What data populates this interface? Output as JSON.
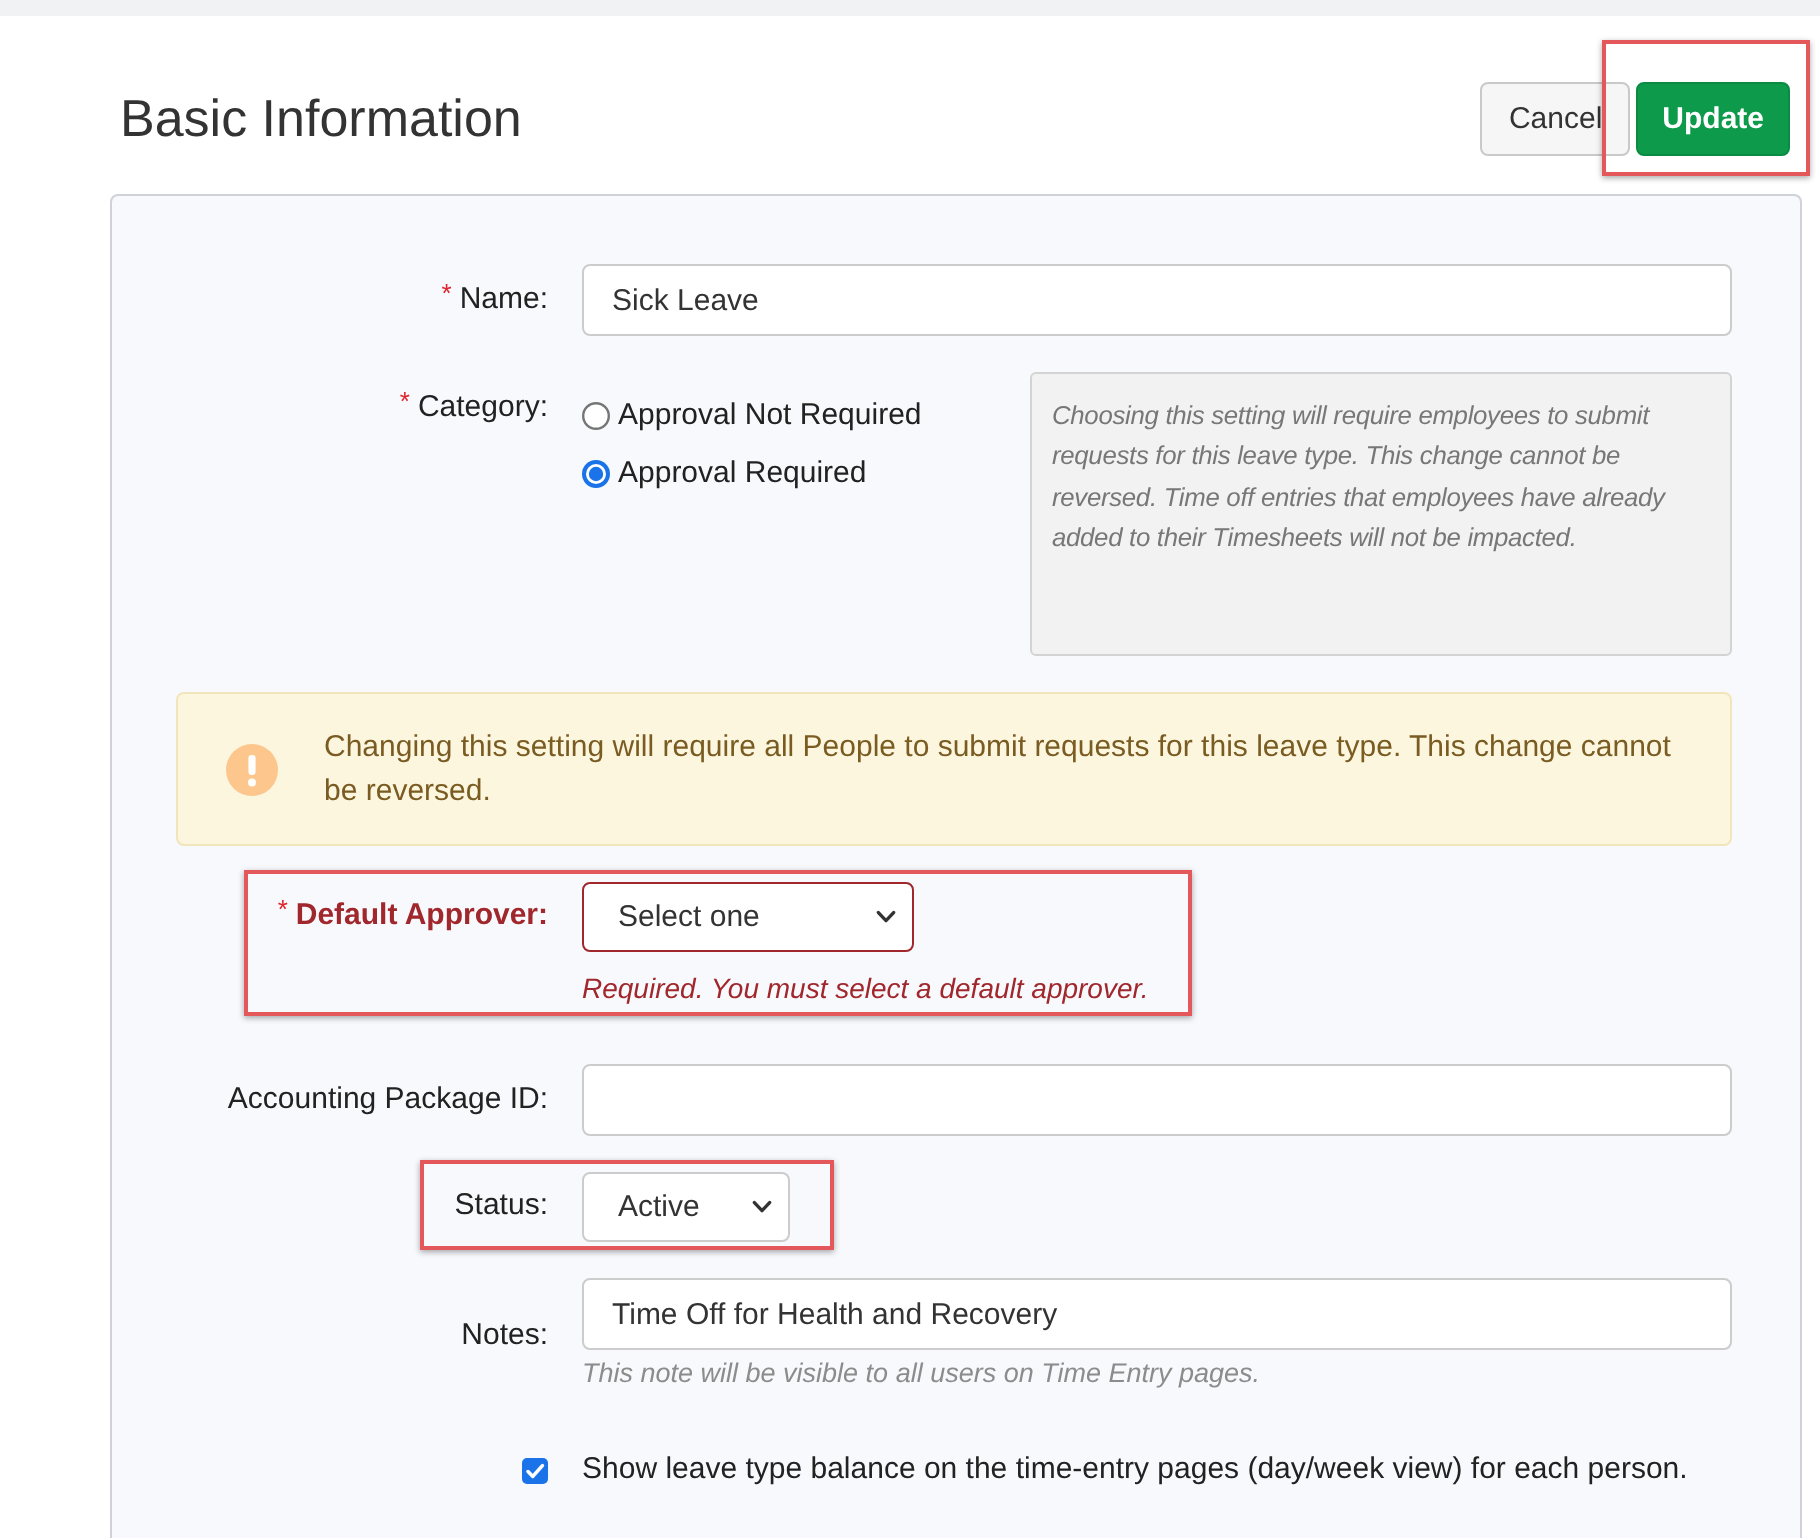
{
  "page": {
    "title": "Basic Information"
  },
  "actions": [
    {
      "label": "Cancel",
      "kind": "secondary",
      "highlighted": false
    },
    {
      "label": "Update",
      "kind": "primary",
      "highlighted": true
    }
  ],
  "rows": [
    {
      "kind": "text",
      "marker": "*",
      "label": "Name:",
      "value": "Sick Leave",
      "invalid": false,
      "highlighted": false
    },
    {
      "kind": "radio",
      "marker": "*",
      "label": "Category:",
      "options": [
        {
          "label": "Approval Not Required",
          "selected": false
        },
        {
          "label": "Approval Required",
          "selected": true
        }
      ],
      "info": "Choosing this setting will require employees to submit requests for this leave type. This change cannot be reversed. Time off entries that employees have already added to their Timesheets will not be impacted.",
      "invalid": false,
      "highlighted": false
    },
    {
      "kind": "alert",
      "text": "Changing this setting will require all People to submit requests for this leave type. This change cannot be reversed."
    },
    {
      "kind": "select",
      "marker": "*",
      "label": "Default Approver:",
      "value": "Select one",
      "error": "Required. You must select a default approver.",
      "invalid": true,
      "highlighted": true
    },
    {
      "kind": "text",
      "label": "Accounting Package ID:",
      "invalid": false,
      "highlighted": false
    },
    {
      "kind": "select",
      "label": "Status:",
      "value": "Active",
      "invalid": false,
      "highlighted": true
    },
    {
      "kind": "text",
      "label": "Notes:",
      "value": "Time Off for Health and Recovery",
      "hint": "This note will be visible to all users on Time Entry pages.",
      "invalid": false,
      "highlighted": false
    },
    {
      "kind": "checkbox",
      "label": "Show leave type balance on the time-entry pages (day/week view) for each person.",
      "checked": true
    }
  ]
}
